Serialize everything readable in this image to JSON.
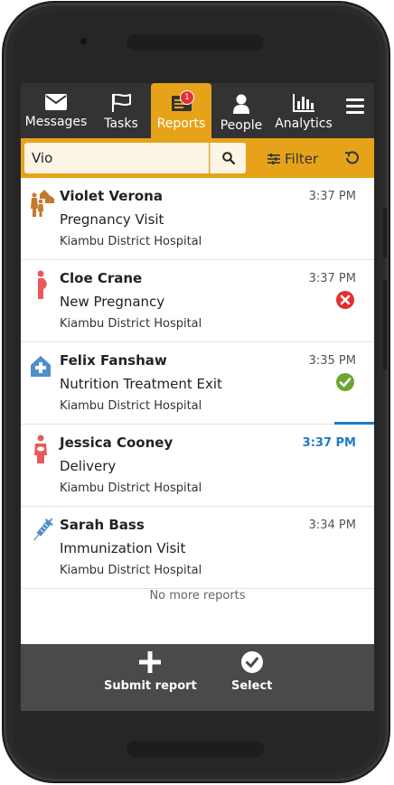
{
  "nav": {
    "tabs": [
      {
        "label": "Messages",
        "icon": "envelope-icon"
      },
      {
        "label": "Tasks",
        "icon": "flag-icon"
      },
      {
        "label": "Reports",
        "icon": "reports-icon",
        "badge": "1",
        "active": true
      },
      {
        "label": "People",
        "icon": "person-icon"
      },
      {
        "label": "Analytics",
        "icon": "bar-chart-icon"
      }
    ],
    "menu_icon": "hamburger-icon"
  },
  "search": {
    "value": "Vio",
    "filter_label": "Filter"
  },
  "reports": [
    {
      "name": "Violet Verona",
      "form": "Pregnancy Visit",
      "place": "Kiambu District Hospital",
      "time": "3:37 PM",
      "icon": "family-home-icon",
      "status": ""
    },
    {
      "name": "Cloe Crane",
      "form": "New Pregnancy",
      "place": "Kiambu District Hospital",
      "time": "3:37 PM",
      "icon": "pregnancy-icon",
      "status": "error"
    },
    {
      "name": "Felix Fanshaw",
      "form": "Nutrition Treatment Exit",
      "place": "Kiambu District Hospital",
      "time": "3:35 PM",
      "icon": "health-facility-icon",
      "status": "verified"
    },
    {
      "name": "Jessica Cooney",
      "form": "Delivery",
      "place": "Kiambu District Hospital",
      "time": "3:37 PM",
      "icon": "mother-baby-icon",
      "status": "",
      "selected": true
    },
    {
      "name": "Sarah Bass",
      "form": "Immunization Visit",
      "place": "Kiambu District Hospital",
      "time": "3:34 PM",
      "icon": "syringe-icon",
      "status": ""
    }
  ],
  "no_more": "No more reports",
  "actions": {
    "submit_label": "Submit report",
    "select_label": "Select"
  },
  "colors": {
    "accent": "#e6a31a",
    "nav_bg": "#333333",
    "error": "#e33030",
    "success": "#6ba632",
    "selected_time": "#1e7ac7"
  }
}
